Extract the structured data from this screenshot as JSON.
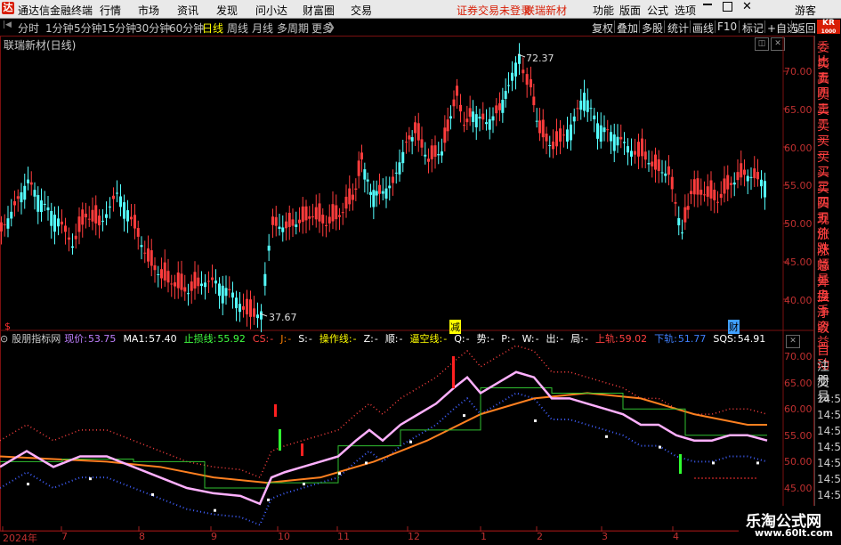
{
  "app": {
    "logo_glyph": "达",
    "title": "通达信金融终端"
  },
  "menu": [
    "行情",
    "市场",
    "资讯",
    "发现",
    "问小达",
    "财富圈",
    "交易"
  ],
  "notice": "证券交易未登录",
  "stock_title": "联瑞新材",
  "menu_right": [
    "功能",
    "版面",
    "公式",
    "选项"
  ],
  "guest": "游客",
  "periods": [
    {
      "label": "分时",
      "active": false
    },
    {
      "label": "1分钟",
      "active": false
    },
    {
      "label": "5分钟",
      "active": false
    },
    {
      "label": "15分钟",
      "active": false
    },
    {
      "label": "30分钟",
      "active": false
    },
    {
      "label": "60分钟",
      "active": false
    },
    {
      "label": "日线",
      "active": true
    },
    {
      "label": "周线",
      "active": false
    },
    {
      "label": "月线",
      "active": false
    },
    {
      "label": "多周期",
      "active": false
    },
    {
      "label": "更多",
      "active": false
    }
  ],
  "toolbar_right": [
    "复权",
    "叠加",
    "多股",
    "统计",
    "画线",
    "F10",
    "标记",
    "+自选",
    "返回"
  ],
  "chart_header": "联瑞新材(日线)",
  "main_axis": [
    "70.00",
    "65.00",
    "60.00",
    "55.00",
    "50.00",
    "45.00",
    "40.00"
  ],
  "high_label": "72.37",
  "low_label": "37.67",
  "markers": [
    {
      "text": "$",
      "color": "#ff3030"
    },
    {
      "text": "减",
      "color": "#ffff00"
    },
    {
      "text": "财",
      "color": "#40a0ff"
    }
  ],
  "indicator": {
    "name": "股朋指标网",
    "fields": [
      {
        "label": "现价:",
        "value": "53.75",
        "color": "#c080ff"
      },
      {
        "label": "MA1:",
        "value": "57.40",
        "color": "#ffffff"
      },
      {
        "label": "止损线:",
        "value": "55.92",
        "color": "#40ff40"
      },
      {
        "label": "CS:",
        "value": "-",
        "color": "#ff4040"
      },
      {
        "label": "J:",
        "value": "-",
        "color": "#ff8000"
      },
      {
        "label": "S:",
        "value": "-",
        "color": "#ffffff"
      },
      {
        "label": "操作线:",
        "value": "-",
        "color": "#ffff00"
      },
      {
        "label": "Z:",
        "value": "-",
        "color": "#ffffff"
      },
      {
        "label": "顺:",
        "value": "-",
        "color": "#ffffff"
      },
      {
        "label": "逼空线:",
        "value": "-",
        "color": "#ffff00"
      },
      {
        "label": "Q:",
        "value": "-",
        "color": "#ffffff"
      },
      {
        "label": "势:",
        "value": "-",
        "color": "#ffffff"
      },
      {
        "label": "P:",
        "value": "-",
        "color": "#ffffff"
      },
      {
        "label": "W:",
        "value": "-",
        "color": "#ffffff"
      },
      {
        "label": "出:",
        "value": "-",
        "color": "#ffffff"
      },
      {
        "label": "局:",
        "value": "-",
        "color": "#ffffff"
      },
      {
        "label": "上轨:",
        "value": "59.02",
        "color": "#ff4040"
      },
      {
        "label": "下轨:",
        "value": "51.77",
        "color": "#4080ff"
      },
      {
        "label": "SQS:",
        "value": "54.91",
        "color": "#ffffff"
      }
    ]
  },
  "ind_axis": [
    "70.00",
    "65.00",
    "60.00",
    "55.00",
    "50.00",
    "45.00"
  ],
  "dates": [
    "2024年",
    "7",
    "8",
    "9",
    "10",
    "11",
    "12",
    "1",
    "2",
    "3",
    "4"
  ],
  "side_top": [
    "委比",
    "卖五",
    "卖四",
    "卖三",
    "卖二",
    "卖一",
    "买一",
    "买二",
    "买三",
    "买四",
    "买五",
    "现价",
    "涨跌",
    "涨幅",
    "总量",
    "外盘",
    "换手",
    "净资",
    "收益"
  ],
  "side_bottom": [
    "自动",
    "注册",
    "交易"
  ],
  "side_times": [
    "14:56",
    "14:56",
    "14:56",
    "14:56",
    "14:56",
    "14:56",
    "14:56",
    "14:56"
  ],
  "kr_badge": "KR",
  "kr_sub": "1000",
  "watermark": {
    "title": "乐淘公式网",
    "url": "www.60lt.com"
  },
  "colors": {
    "up": "#ff3c3c",
    "down": "#54ffff",
    "menu_bg": "#e9e9e9"
  }
}
